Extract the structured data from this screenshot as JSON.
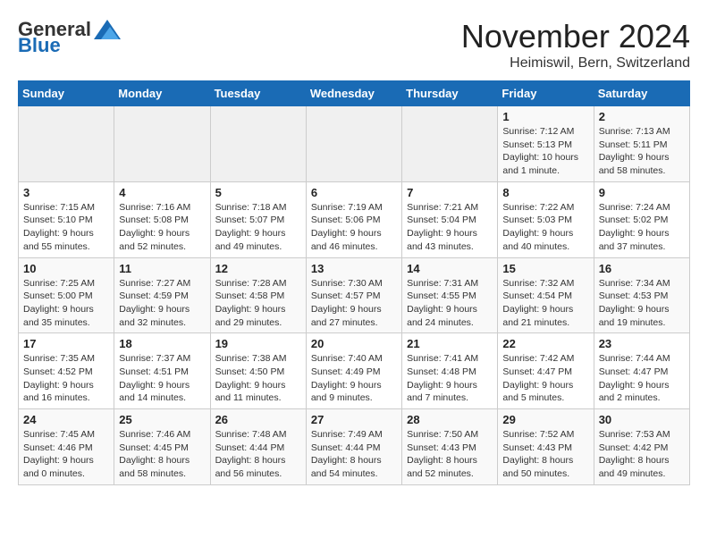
{
  "logo": {
    "general": "General",
    "blue": "Blue"
  },
  "title": "November 2024",
  "subtitle": "Heimiswil, Bern, Switzerland",
  "headers": [
    "Sunday",
    "Monday",
    "Tuesday",
    "Wednesday",
    "Thursday",
    "Friday",
    "Saturday"
  ],
  "weeks": [
    [
      {
        "day": "",
        "info": ""
      },
      {
        "day": "",
        "info": ""
      },
      {
        "day": "",
        "info": ""
      },
      {
        "day": "",
        "info": ""
      },
      {
        "day": "",
        "info": ""
      },
      {
        "day": "1",
        "info": "Sunrise: 7:12 AM\nSunset: 5:13 PM\nDaylight: 10 hours and 1 minute."
      },
      {
        "day": "2",
        "info": "Sunrise: 7:13 AM\nSunset: 5:11 PM\nDaylight: 9 hours and 58 minutes."
      }
    ],
    [
      {
        "day": "3",
        "info": "Sunrise: 7:15 AM\nSunset: 5:10 PM\nDaylight: 9 hours and 55 minutes."
      },
      {
        "day": "4",
        "info": "Sunrise: 7:16 AM\nSunset: 5:08 PM\nDaylight: 9 hours and 52 minutes."
      },
      {
        "day": "5",
        "info": "Sunrise: 7:18 AM\nSunset: 5:07 PM\nDaylight: 9 hours and 49 minutes."
      },
      {
        "day": "6",
        "info": "Sunrise: 7:19 AM\nSunset: 5:06 PM\nDaylight: 9 hours and 46 minutes."
      },
      {
        "day": "7",
        "info": "Sunrise: 7:21 AM\nSunset: 5:04 PM\nDaylight: 9 hours and 43 minutes."
      },
      {
        "day": "8",
        "info": "Sunrise: 7:22 AM\nSunset: 5:03 PM\nDaylight: 9 hours and 40 minutes."
      },
      {
        "day": "9",
        "info": "Sunrise: 7:24 AM\nSunset: 5:02 PM\nDaylight: 9 hours and 37 minutes."
      }
    ],
    [
      {
        "day": "10",
        "info": "Sunrise: 7:25 AM\nSunset: 5:00 PM\nDaylight: 9 hours and 35 minutes."
      },
      {
        "day": "11",
        "info": "Sunrise: 7:27 AM\nSunset: 4:59 PM\nDaylight: 9 hours and 32 minutes."
      },
      {
        "day": "12",
        "info": "Sunrise: 7:28 AM\nSunset: 4:58 PM\nDaylight: 9 hours and 29 minutes."
      },
      {
        "day": "13",
        "info": "Sunrise: 7:30 AM\nSunset: 4:57 PM\nDaylight: 9 hours and 27 minutes."
      },
      {
        "day": "14",
        "info": "Sunrise: 7:31 AM\nSunset: 4:55 PM\nDaylight: 9 hours and 24 minutes."
      },
      {
        "day": "15",
        "info": "Sunrise: 7:32 AM\nSunset: 4:54 PM\nDaylight: 9 hours and 21 minutes."
      },
      {
        "day": "16",
        "info": "Sunrise: 7:34 AM\nSunset: 4:53 PM\nDaylight: 9 hours and 19 minutes."
      }
    ],
    [
      {
        "day": "17",
        "info": "Sunrise: 7:35 AM\nSunset: 4:52 PM\nDaylight: 9 hours and 16 minutes."
      },
      {
        "day": "18",
        "info": "Sunrise: 7:37 AM\nSunset: 4:51 PM\nDaylight: 9 hours and 14 minutes."
      },
      {
        "day": "19",
        "info": "Sunrise: 7:38 AM\nSunset: 4:50 PM\nDaylight: 9 hours and 11 minutes."
      },
      {
        "day": "20",
        "info": "Sunrise: 7:40 AM\nSunset: 4:49 PM\nDaylight: 9 hours and 9 minutes."
      },
      {
        "day": "21",
        "info": "Sunrise: 7:41 AM\nSunset: 4:48 PM\nDaylight: 9 hours and 7 minutes."
      },
      {
        "day": "22",
        "info": "Sunrise: 7:42 AM\nSunset: 4:47 PM\nDaylight: 9 hours and 5 minutes."
      },
      {
        "day": "23",
        "info": "Sunrise: 7:44 AM\nSunset: 4:47 PM\nDaylight: 9 hours and 2 minutes."
      }
    ],
    [
      {
        "day": "24",
        "info": "Sunrise: 7:45 AM\nSunset: 4:46 PM\nDaylight: 9 hours and 0 minutes."
      },
      {
        "day": "25",
        "info": "Sunrise: 7:46 AM\nSunset: 4:45 PM\nDaylight: 8 hours and 58 minutes."
      },
      {
        "day": "26",
        "info": "Sunrise: 7:48 AM\nSunset: 4:44 PM\nDaylight: 8 hours and 56 minutes."
      },
      {
        "day": "27",
        "info": "Sunrise: 7:49 AM\nSunset: 4:44 PM\nDaylight: 8 hours and 54 minutes."
      },
      {
        "day": "28",
        "info": "Sunrise: 7:50 AM\nSunset: 4:43 PM\nDaylight: 8 hours and 52 minutes."
      },
      {
        "day": "29",
        "info": "Sunrise: 7:52 AM\nSunset: 4:43 PM\nDaylight: 8 hours and 50 minutes."
      },
      {
        "day": "30",
        "info": "Sunrise: 7:53 AM\nSunset: 4:42 PM\nDaylight: 8 hours and 49 minutes."
      }
    ]
  ]
}
